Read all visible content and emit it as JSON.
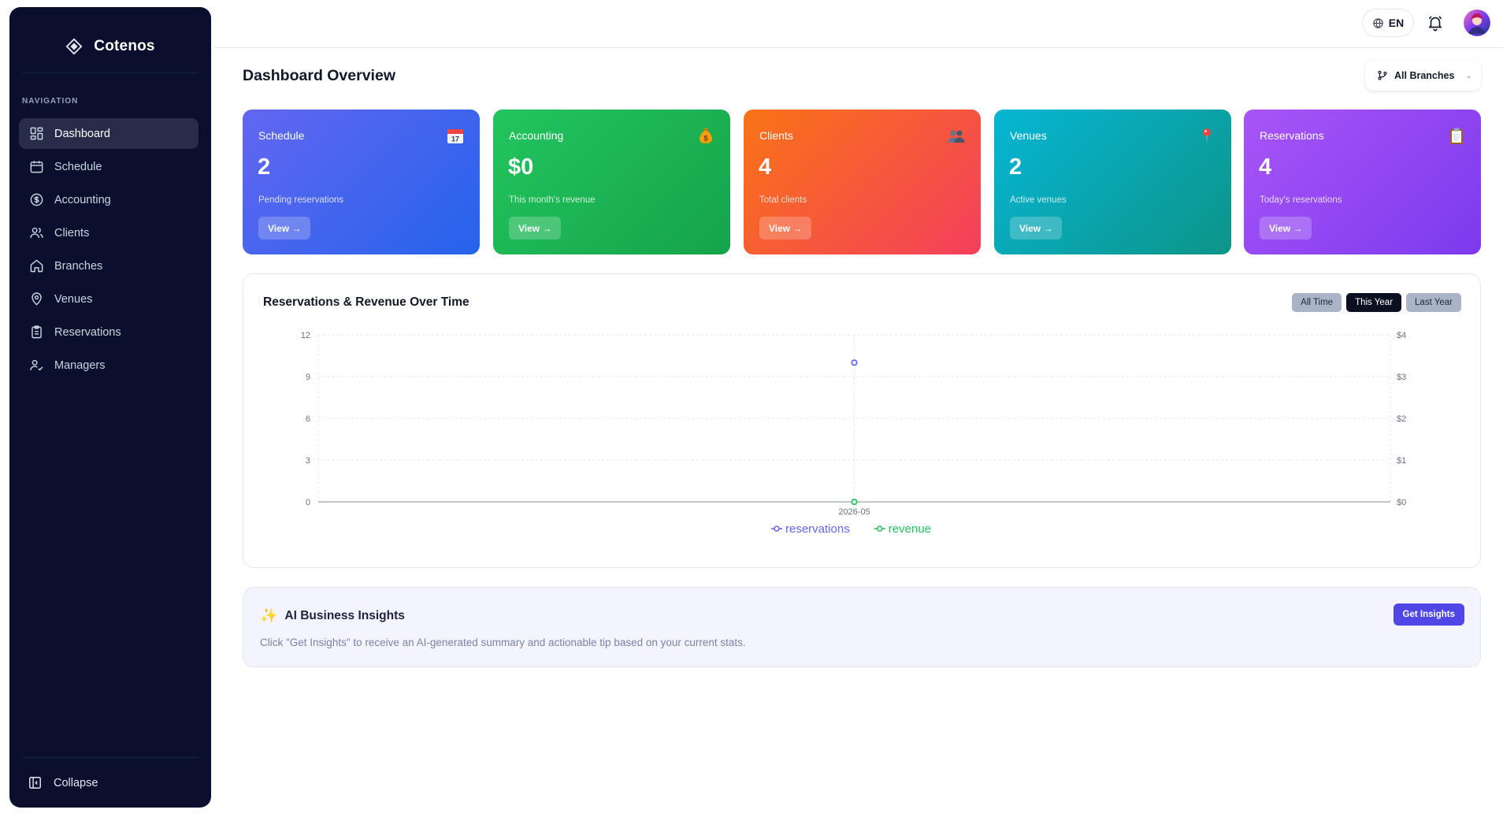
{
  "brand": {
    "name": "Cotenos"
  },
  "sidebar": {
    "heading": "NAVIGATION",
    "items": [
      {
        "label": "Dashboard",
        "icon": "dashboard-icon",
        "active": true
      },
      {
        "label": "Schedule",
        "icon": "calendar-icon"
      },
      {
        "label": "Accounting",
        "icon": "dollar-circle-icon"
      },
      {
        "label": "Clients",
        "icon": "users-icon"
      },
      {
        "label": "Branches",
        "icon": "home-icon"
      },
      {
        "label": "Venues",
        "icon": "map-pin-icon"
      },
      {
        "label": "Reservations",
        "icon": "clipboard-icon"
      },
      {
        "label": "Managers",
        "icon": "user-check-icon"
      }
    ],
    "collapse_label": "Collapse"
  },
  "topbar": {
    "language": "EN"
  },
  "main": {
    "title": "Dashboard Overview",
    "branch_filter": "All Branches",
    "cards": [
      {
        "title": "Schedule",
        "value": "2",
        "subtitle": "Pending reservations",
        "button": "View →",
        "icon": "calendar-emoji-icon"
      },
      {
        "title": "Accounting",
        "value": "$0",
        "subtitle": "This month's revenue",
        "button": "View →",
        "icon": "money-bag-icon"
      },
      {
        "title": "Clients",
        "value": "4",
        "subtitle": "Total clients",
        "button": "View →",
        "icon": "people-icon"
      },
      {
        "title": "Venues",
        "value": "2",
        "subtitle": "Active venues",
        "button": "View →",
        "icon": "pushpin-icon"
      },
      {
        "title": "Reservations",
        "value": "4",
        "subtitle": "Today's reservations",
        "button": "View →",
        "icon": "clipboard-emoji-icon"
      }
    ],
    "chart_panel": {
      "title": "Reservations & Revenue Over Time",
      "ranges": [
        "All Time",
        "This Year",
        "Last Year"
      ],
      "active_range": "This Year"
    },
    "insights": {
      "title": "AI Business Insights",
      "text": "Click \"Get Insights\" to receive an AI-generated summary and actionable tip based on your current stats.",
      "button": "Get Insights"
    }
  },
  "colors": {
    "sidebar_bg": "#0b0f2e",
    "reservations_series": "#6366f1",
    "revenue_series": "#22c55e",
    "accent": "#4f46e5"
  },
  "chart_data": {
    "type": "line",
    "x": [
      "2026-05"
    ],
    "series": [
      {
        "name": "reservations",
        "axis": "left",
        "values": [
          10
        ]
      },
      {
        "name": "revenue",
        "axis": "right",
        "values": [
          0
        ]
      }
    ],
    "y_left": {
      "ticks": [
        "0",
        "3",
        "6",
        "9",
        "12"
      ],
      "range": [
        0,
        12
      ]
    },
    "y_right": {
      "ticks": [
        "$0",
        "$1",
        "$2",
        "$3",
        "$4"
      ],
      "range": [
        0,
        4
      ]
    },
    "legend": "bottom",
    "grid": true
  }
}
